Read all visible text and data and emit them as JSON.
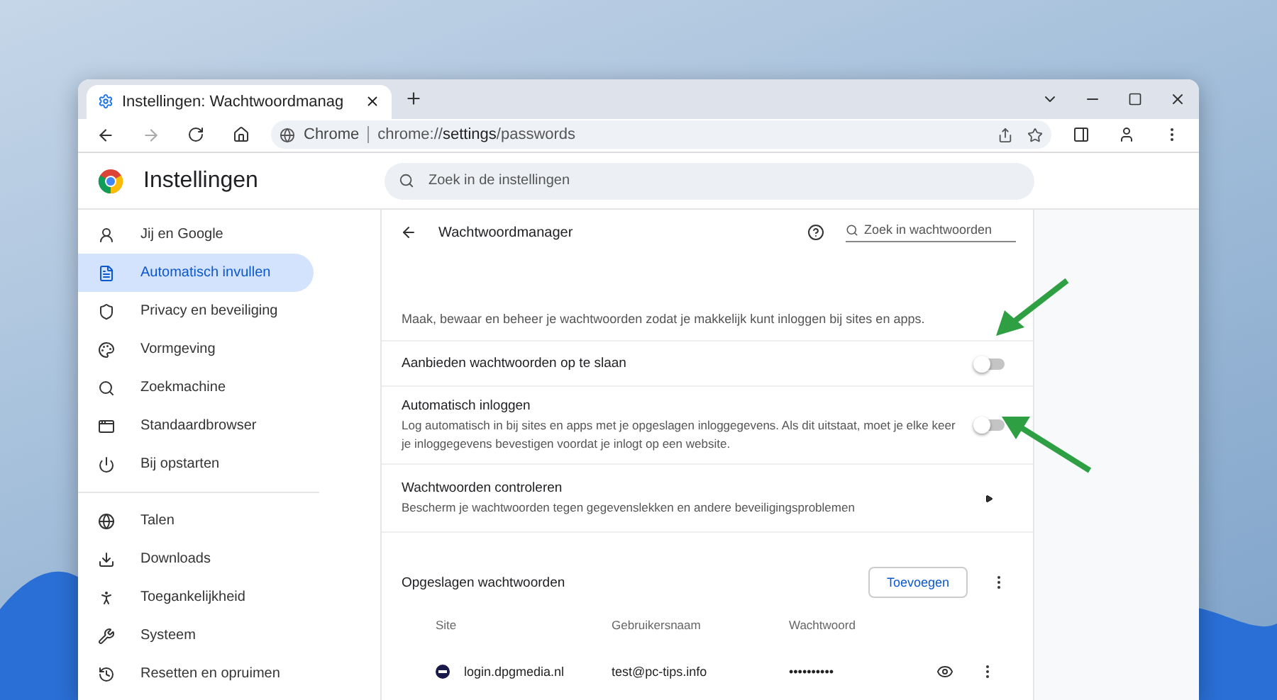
{
  "tab": {
    "title": "Instellingen: Wachtwoordmanag",
    "selected": true
  },
  "address_bar": {
    "chip": "Chrome",
    "url_plain": "chrome://",
    "url_bold": "settings",
    "url_rest": "/passwords"
  },
  "header": {
    "title": "Instellingen",
    "search_placeholder": "Zoek in de instellingen"
  },
  "sidebar": {
    "groups": [
      [
        {
          "label": "Jij en Google",
          "selected": false
        },
        {
          "label": "Automatisch invullen",
          "selected": true
        },
        {
          "label": "Privacy en beveiliging",
          "selected": false
        },
        {
          "label": "Vormgeving",
          "selected": false
        },
        {
          "label": "Zoekmachine",
          "selected": false
        },
        {
          "label": "Standaardbrowser",
          "selected": false
        },
        {
          "label": "Bij opstarten",
          "selected": false
        }
      ],
      [
        {
          "label": "Talen",
          "selected": false
        },
        {
          "label": "Downloads",
          "selected": false
        },
        {
          "label": "Toegankelijkheid",
          "selected": false
        },
        {
          "label": "Systeem",
          "selected": false
        },
        {
          "label": "Resetten en opruimen",
          "selected": false
        }
      ]
    ]
  },
  "page": {
    "title": "Wachtwoordmanager",
    "search_placeholder": "Zoek in wachtwoorden",
    "intro": "Maak, bewaar en beheer je wachtwoorden zodat je makkelijk kunt inloggen bij sites en apps.",
    "settings": [
      {
        "title": "Aanbieden wachtwoorden op te slaan",
        "on": false
      },
      {
        "title": "Automatisch inloggen",
        "description": "Log automatisch in bij sites en apps met je opgeslagen inloggegevens. Als dit uitstaat, moet je elke keer je inloggegevens bevestigen voordat je inlogt op een website.",
        "on": false
      }
    ],
    "check": {
      "title": "Wachtwoorden controleren",
      "description": "Bescherm je wachtwoorden tegen gegevenslekken en andere beveiligingsproblemen"
    },
    "saved": {
      "title": "Opgeslagen wachtwoorden",
      "add_button": "Toevoegen",
      "columns": [
        "Site",
        "Gebruikersnaam",
        "Wachtwoord"
      ],
      "rows": [
        {
          "site": "login.dpgmedia.nl",
          "username": "test@pc-tips.info",
          "password": "••••••••••"
        }
      ]
    }
  }
}
